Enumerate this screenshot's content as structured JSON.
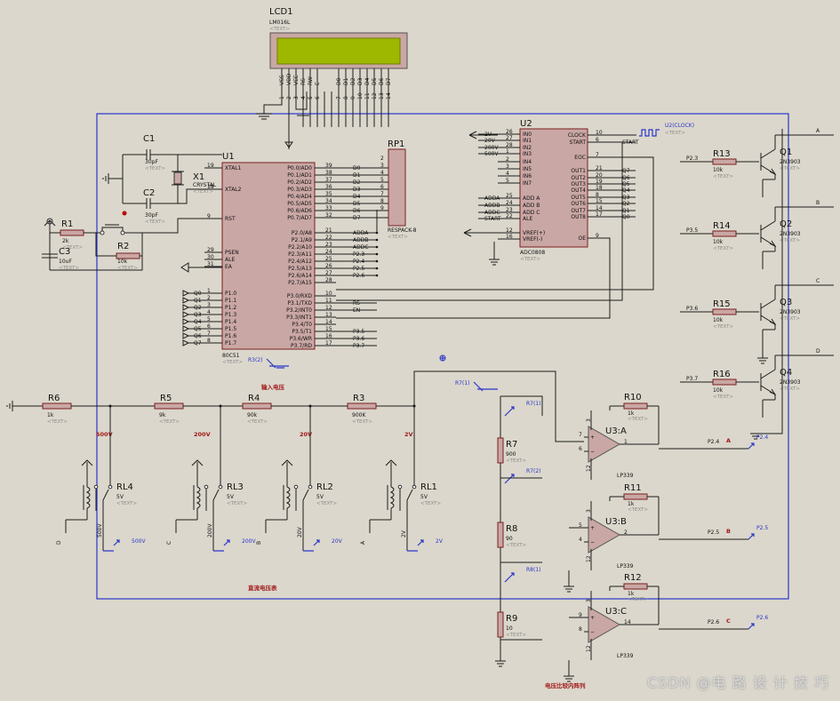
{
  "lcd": {
    "ref": "LCD1",
    "model": "LM016L",
    "text": "<TEXT>",
    "pins": [
      "VSS",
      "VDD",
      "VEE",
      "RS",
      "RW",
      "E",
      "D0",
      "D1",
      "D2",
      "D3",
      "D4",
      "D5",
      "D6",
      "D7"
    ],
    "pin_nums": [
      "1",
      "2",
      "3",
      "4",
      "5",
      "6",
      "7",
      "8",
      "9",
      "10",
      "11",
      "12",
      "13",
      "14"
    ]
  },
  "u1": {
    "ref": "U1",
    "model": "80C51",
    "text": "<TEXT>",
    "left_pins": [
      [
        "19",
        "XTAL1"
      ],
      [
        "18",
        "XTAL2"
      ],
      [
        "9",
        "RST"
      ],
      [
        "29",
        "PSEN"
      ],
      [
        "30",
        "ALE"
      ],
      [
        "31",
        "EA"
      ],
      [
        "1",
        "P1.0"
      ],
      [
        "2",
        "P1.1"
      ],
      [
        "3",
        "P1.2"
      ],
      [
        "4",
        "P1.3"
      ],
      [
        "5",
        "P1.4"
      ],
      [
        "6",
        "P1.5"
      ],
      [
        "7",
        "P1.6"
      ],
      [
        "8",
        "P1.7"
      ]
    ],
    "right_pins": [
      [
        "39",
        "P0.0/AD0"
      ],
      [
        "38",
        "P0.1/AD1"
      ],
      [
        "37",
        "P0.2/AD2"
      ],
      [
        "36",
        "P0.3/AD3"
      ],
      [
        "35",
        "P0.4/AD4"
      ],
      [
        "34",
        "P0.5/AD5"
      ],
      [
        "33",
        "P0.6/AD6"
      ],
      [
        "32",
        "P0.7/AD7"
      ],
      [
        "21",
        "P2.0/A8"
      ],
      [
        "22",
        "P2.1/A9"
      ],
      [
        "23",
        "P2.2/A10"
      ],
      [
        "24",
        "P2.3/A11"
      ],
      [
        "25",
        "P2.4/A12"
      ],
      [
        "26",
        "P2.5/A13"
      ],
      [
        "27",
        "P2.6/A14"
      ],
      [
        "28",
        "P2.7/A15"
      ],
      [
        "10",
        "P3.0/RXD"
      ],
      [
        "11",
        "P3.1/TXD"
      ],
      [
        "12",
        "P3.2/INT0"
      ],
      [
        "13",
        "P3.3/INT1"
      ],
      [
        "14",
        "P3.4/T0"
      ],
      [
        "15",
        "P3.5/T1"
      ],
      [
        "16",
        "P3.6/WR"
      ],
      [
        "17",
        "P3.7/RD"
      ]
    ],
    "right_nets": [
      "D0",
      "D1",
      "D2",
      "D3",
      "D4",
      "D5",
      "D6",
      "D7",
      "ADDA",
      "ADDB",
      "ADDC",
      "P2.3",
      "P2.4",
      "P2.5",
      "P2.6",
      "",
      "",
      "RS",
      "EN",
      "",
      "",
      "P3.5",
      "P3.6",
      "P3.7"
    ],
    "left_nets": [
      "Q0",
      "Q1",
      "Q2",
      "Q3",
      "Q4",
      "Q5",
      "Q6",
      "Q7"
    ]
  },
  "rp1": {
    "ref": "RP1",
    "model": "RESPACK-8",
    "text": "<TEXT>",
    "pins": [
      "1",
      "2",
      "3",
      "4",
      "5",
      "6",
      "7",
      "8",
      "9"
    ]
  },
  "u2": {
    "ref": "U2",
    "model": "ADC0808",
    "text": "<TEXT>",
    "left_pins": [
      [
        "26",
        "IN0"
      ],
      [
        "27",
        "IN1"
      ],
      [
        "28",
        "IN2"
      ],
      [
        "1",
        "IN3"
      ],
      [
        "2",
        "IN4"
      ],
      [
        "3",
        "IN5"
      ],
      [
        "4",
        "IN6"
      ],
      [
        "5",
        "IN7"
      ],
      [
        "25",
        "ADD A"
      ],
      [
        "24",
        "ADD B"
      ],
      [
        "23",
        "ADD C"
      ],
      [
        "22",
        "ALE"
      ],
      [
        "12",
        "VREF(+)"
      ],
      [
        "16",
        "VREF(-)"
      ]
    ],
    "left_nets": [
      "2V",
      "20V",
      "200V",
      "500V",
      "",
      "",
      "",
      "",
      "ADDA",
      "ADDB",
      "ADDC",
      "START",
      "",
      ""
    ],
    "right_pins": [
      [
        "10",
        "CLOCK"
      ],
      [
        "6",
        "START"
      ],
      [
        "7",
        "EOC"
      ],
      [
        "21",
        "OUT1"
      ],
      [
        "20",
        "OUT2"
      ],
      [
        "19",
        "OUT3"
      ],
      [
        "18",
        "OUT4"
      ],
      [
        "8",
        "OUT5"
      ],
      [
        "15",
        "OUT6"
      ],
      [
        "14",
        "OUT7"
      ],
      [
        "17",
        "OUT8"
      ],
      [
        "9",
        "OE"
      ]
    ],
    "right_nets": [
      "",
      "START",
      "",
      "Q7",
      "Q6",
      "Q5",
      "Q4",
      "Q3",
      "Q2",
      "Q1",
      "Q0",
      ""
    ],
    "clock": "U2(CLOCK)"
  },
  "x1": {
    "ref": "X1",
    "model": "CRYSTAL",
    "text": "<TEXT>"
  },
  "caps": [
    {
      "ref": "C1",
      "value": "30pF",
      "text": "<TEXT>"
    },
    {
      "ref": "C2",
      "value": "30pF",
      "text": "<TEXT>"
    },
    {
      "ref": "C3",
      "value": "10uF",
      "text": "<TEXT>"
    }
  ],
  "r_top": [
    {
      "ref": "R1",
      "value": "2k",
      "text": "<TEXT>"
    },
    {
      "ref": "R2",
      "value": "10k",
      "text": "<TEXT>"
    }
  ],
  "transistors": [
    {
      "rref": "R13",
      "rval": "10k",
      "net": "P2.3",
      "qref": "Q1",
      "qmodel": "2N3903",
      "out": "A"
    },
    {
      "rref": "R14",
      "rval": "10k",
      "net": "P3.5",
      "qref": "Q2",
      "qmodel": "2N3903",
      "out": "B"
    },
    {
      "rref": "R15",
      "rval": "10k",
      "net": "P3.6",
      "qref": "Q3",
      "qmodel": "2N3903",
      "out": "C"
    },
    {
      "rref": "R16",
      "rval": "10k",
      "net": "P3.7",
      "qref": "Q4",
      "qmodel": "2N3903",
      "out": "D"
    }
  ],
  "divider": [
    {
      "ref": "R6",
      "value": "1k",
      "text": "<TEXT>"
    },
    {
      "ref": "R5",
      "value": "9k",
      "text": "<TEXT>"
    },
    {
      "ref": "R4",
      "value": "90k",
      "text": "<TEXT>"
    },
    {
      "ref": "R3",
      "value": "900K",
      "text": "<TEXT>"
    }
  ],
  "divider_taps": [
    "500V",
    "200V",
    "20V",
    "2V"
  ],
  "input_label": "输入电压",
  "relays": [
    {
      "ref": "RL4",
      "value": "5V",
      "text": "<TEXT>",
      "coil": "D",
      "tap": "500V"
    },
    {
      "ref": "RL3",
      "value": "5V",
      "text": "<TEXT>",
      "coil": "C",
      "tap": "200V"
    },
    {
      "ref": "RL2",
      "value": "5V",
      "text": "<TEXT>",
      "coil": "B",
      "tap": "20V"
    },
    {
      "ref": "RL1",
      "value": "5V",
      "text": "<TEXT>",
      "coil": "A",
      "tap": "2V"
    }
  ],
  "dc_caption": "直流电压表",
  "ladder": [
    {
      "ref": "R7",
      "value": "900",
      "text": "<TEXT>",
      "probe": "R7(1)"
    },
    {
      "ref": "R8",
      "value": "90",
      "text": "<TEXT>",
      "probe": "R7(2)"
    },
    {
      "ref": "R9",
      "value": "10",
      "text": "<TEXT>",
      "probe": "R8(1)"
    }
  ],
  "probe_r3": "R3(2)",
  "probe_r71": "R7(1)",
  "opamps": [
    {
      "ref": "U3:A",
      "model": "LP339",
      "rref": "R10",
      "rval": "1k",
      "net": "P2.4",
      "letter": "A",
      "probe": "P2.4",
      "pins": [
        "7",
        "6",
        "12",
        "1",
        "3"
      ]
    },
    {
      "ref": "U3:B",
      "model": "LP339",
      "rref": "R11",
      "rval": "1k",
      "net": "P2.5",
      "letter": "B",
      "probe": "P2.5",
      "pins": [
        "5",
        "4",
        "12",
        "2",
        "3"
      ]
    },
    {
      "ref": "U3:C",
      "model": "LP339",
      "rref": "R12",
      "rval": "1k",
      "net": "P2.6",
      "letter": "C",
      "probe": "P2.6",
      "pins": [
        "9",
        "8",
        "12",
        "14",
        "3"
      ]
    }
  ],
  "cmp_caption": "电压比较内阵列",
  "watermark": "CSDN @电 路 设 计 技 巧"
}
